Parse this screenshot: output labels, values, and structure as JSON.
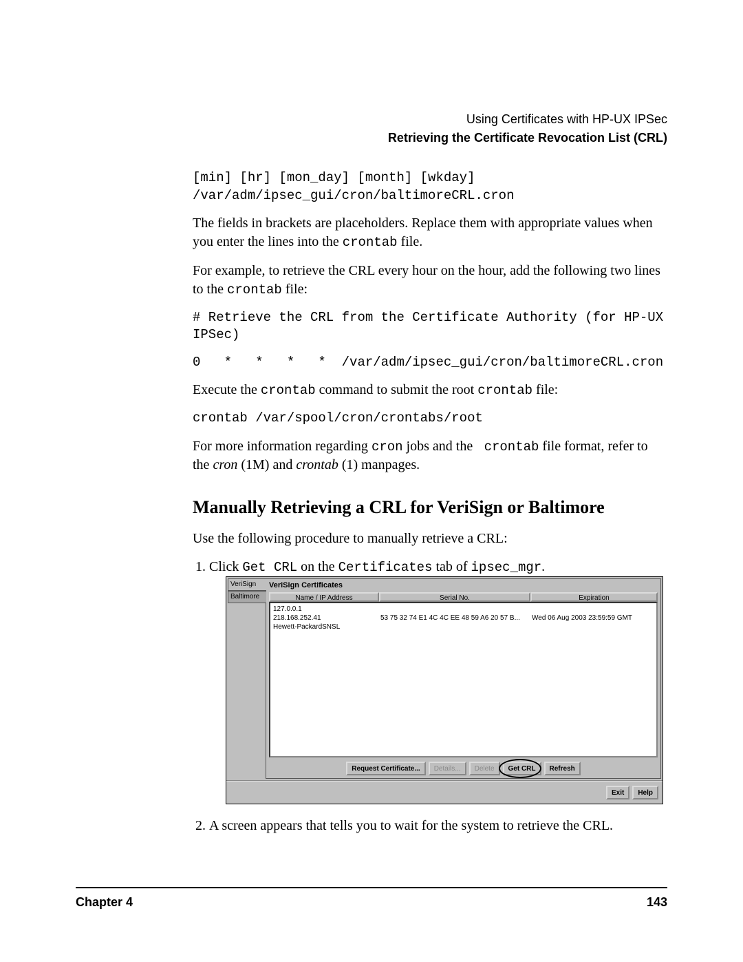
{
  "header": {
    "line1": "Using Certificates with HP-UX IPSec",
    "line2": "Retrieving the Certificate Revocation List (CRL)"
  },
  "code1": "[min] [hr] [mon_day] [month] [wkday]\n/var/adm/ipsec_gui/cron/baltimoreCRL.cron",
  "para1a": "The fields in brackets are placeholders. Replace them with appropriate values when you enter the lines into the ",
  "para1b": " file.",
  "para2a": "For example, to retrieve the CRL every hour on the hour, add the following two lines to the ",
  "para2b": " file:",
  "code2": "# Retrieve the CRL from the Certificate Authority (for HP-UX IPSec)",
  "code3": "0   *   *   *   *  /var/adm/ipsec_gui/cron/baltimoreCRL.cron",
  "para3a": "Execute the ",
  "para3b": " command to submit the root ",
  "para3c": " file:",
  "code4": "crontab /var/spool/cron/crontabs/root",
  "para4a": "For more information regarding ",
  "para4b": " jobs and the ",
  "para4c": " file format, refer to the ",
  "para4d": " (1M) and ",
  "para4e": " (1) manpages.",
  "mono": {
    "crontab": "crontab",
    "cron": "cron",
    "crontab2": " crontab"
  },
  "italic": {
    "cron": "cron",
    "crontab": "crontab"
  },
  "h2": "Manually Retrieving a CRL for VeriSign or Baltimore",
  "para5": "Use the following procedure to manually retrieve a CRL:",
  "step1a": "Click ",
  "step1_code1": "Get CRL",
  "step1b": " on the ",
  "step1_code2": "Certificates",
  "step1c": " tab of ",
  "step1_code3": "ipsec_mgr",
  "step1d": ".",
  "dialog": {
    "tabs": [
      "VeriSign",
      "Baltimore"
    ],
    "panel_title": "VeriSign Certificates",
    "columns": [
      "Name / IP Address",
      "Serial No.",
      "Expiration"
    ],
    "rows": [
      {
        "name": "127.0.0.1",
        "serial": "",
        "exp": ""
      },
      {
        "name": "218.168.252.41",
        "serial": "53 75 32 74 E1 4C 4C EE 48 59 A6 20 57 B...",
        "exp": "Wed 06 Aug 2003 23:59:59 GMT"
      },
      {
        "name": "Hewett-PackardSNSL",
        "serial": "",
        "exp": ""
      }
    ],
    "buttons": {
      "request": "Request Certificate...",
      "details": "Details...",
      "delete": "Delete",
      "get_crl": "Get CRL",
      "refresh": "Refresh",
      "exit": "Exit",
      "help": "Help"
    }
  },
  "step2": "A screen appears that tells you to wait for the system to retrieve the CRL.",
  "footer": {
    "chapter": "Chapter 4",
    "page": "143"
  }
}
